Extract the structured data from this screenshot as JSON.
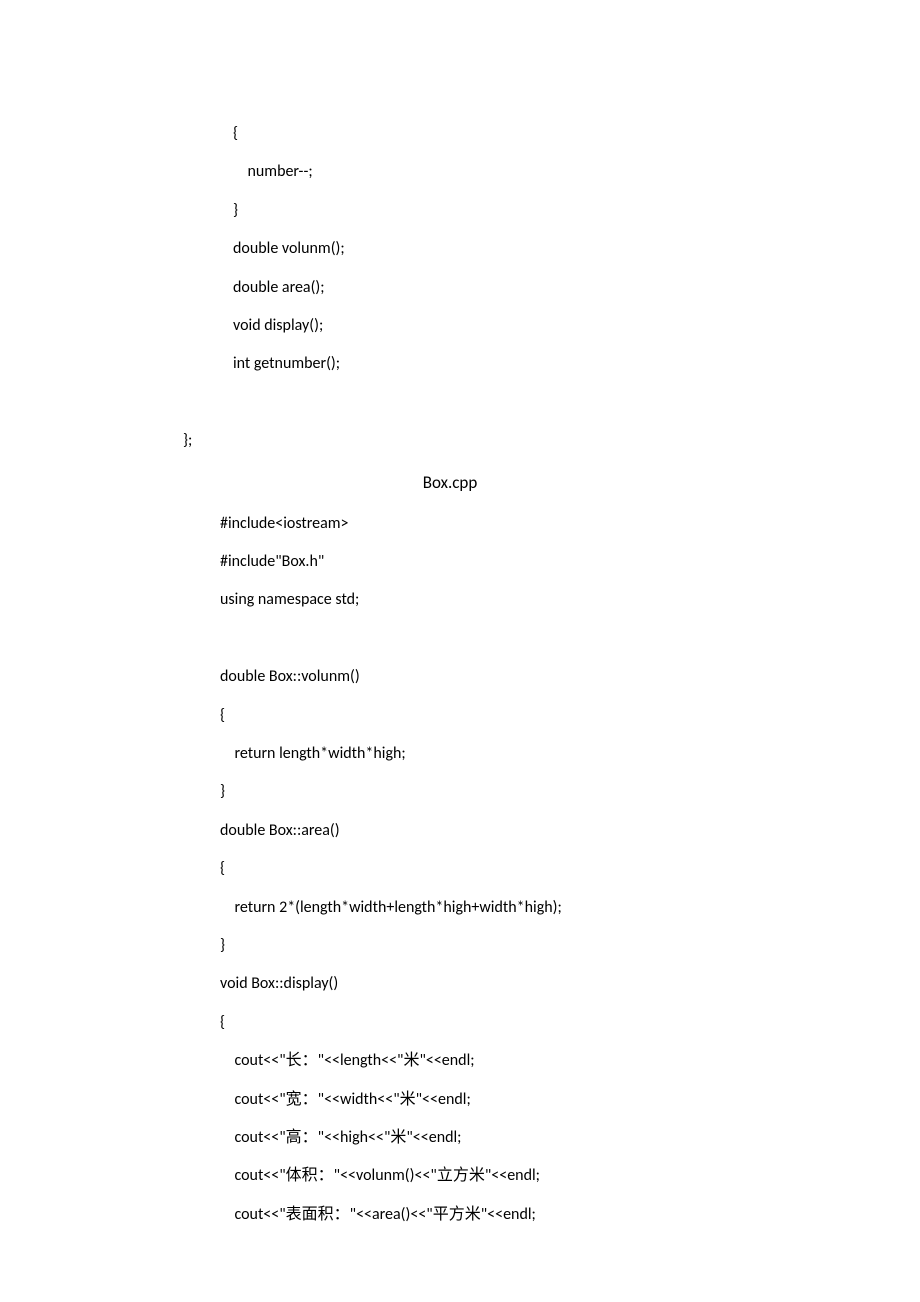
{
  "hdr": {
    "l1": "{",
    "l2": "    number--;",
    "l3": "}",
    "l4": "double volunm();",
    "l5": "double area();",
    "l6": "void display();",
    "l7": "int getnumber();",
    "close": "};"
  },
  "title": "Box.cpp",
  "cpp": {
    "l1": "#include<iostream>",
    "l2": "#include\"Box.h\"",
    "l3": "using namespace std;",
    "l4": "",
    "l5": "double Box::volunm()",
    "l6": "{",
    "l7": "    return length*width*high;",
    "l8": "}",
    "l9": "double Box::area()",
    "l10": "{",
    "l11": "    return 2*(length*width+length*high+width*high);",
    "l12": "}",
    "l13": "void Box::display()",
    "l14": "{",
    "l15": "    cout<<\"长：\"<<length<<\"米\"<<endl;",
    "l16": "    cout<<\"宽：\"<<width<<\"米\"<<endl;",
    "l17": "    cout<<\"高：\"<<high<<\"米\"<<endl;",
    "l18": "    cout<<\"体积：\"<<volunm()<<\"立方米\"<<endl;",
    "l19": "    cout<<\"表面积：\"<<area()<<\"平方米\"<<endl;"
  }
}
